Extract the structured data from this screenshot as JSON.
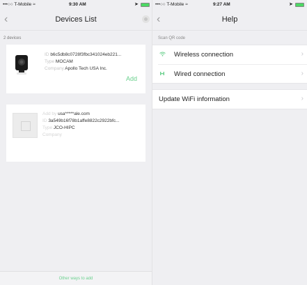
{
  "left": {
    "status": {
      "carrier": "•••○○ T-Mobile ≈",
      "time": "9:30 AM"
    },
    "title": "Devices List",
    "count_label": "2 devices",
    "devices": [
      {
        "id_label": "ID",
        "id_value": "b6c5db8c0728f3fbc341024eb221...",
        "type_label": "Type",
        "type_value": "MOCAM",
        "company_label": "Company",
        "company_value": "Apollo Tech USA Inc.",
        "action": "Add"
      },
      {
        "added_label": "Add by",
        "added_value": "usa*****ale.com",
        "id_label": "ID",
        "id_value": "3a549b16f78b1affe8822c2922bfc...",
        "type_label": "Type",
        "type_value": "JCO-HIPC",
        "company_label": "Company",
        "company_value": ""
      }
    ],
    "footer": "Other ways to add"
  },
  "right": {
    "status": {
      "carrier": "•••○○ T-Mobile ≈",
      "time": "9:27 AM"
    },
    "title": "Help",
    "section_label": "Scan QR code",
    "items": [
      {
        "label": "Wireless connection",
        "icon": "wifi-icon"
      },
      {
        "label": "Wired connection",
        "icon": "ethernet-icon"
      }
    ],
    "update_label": "Update WiFi information"
  },
  "colors": {
    "accent": "#6bd08e",
    "background": "#efeff2"
  }
}
